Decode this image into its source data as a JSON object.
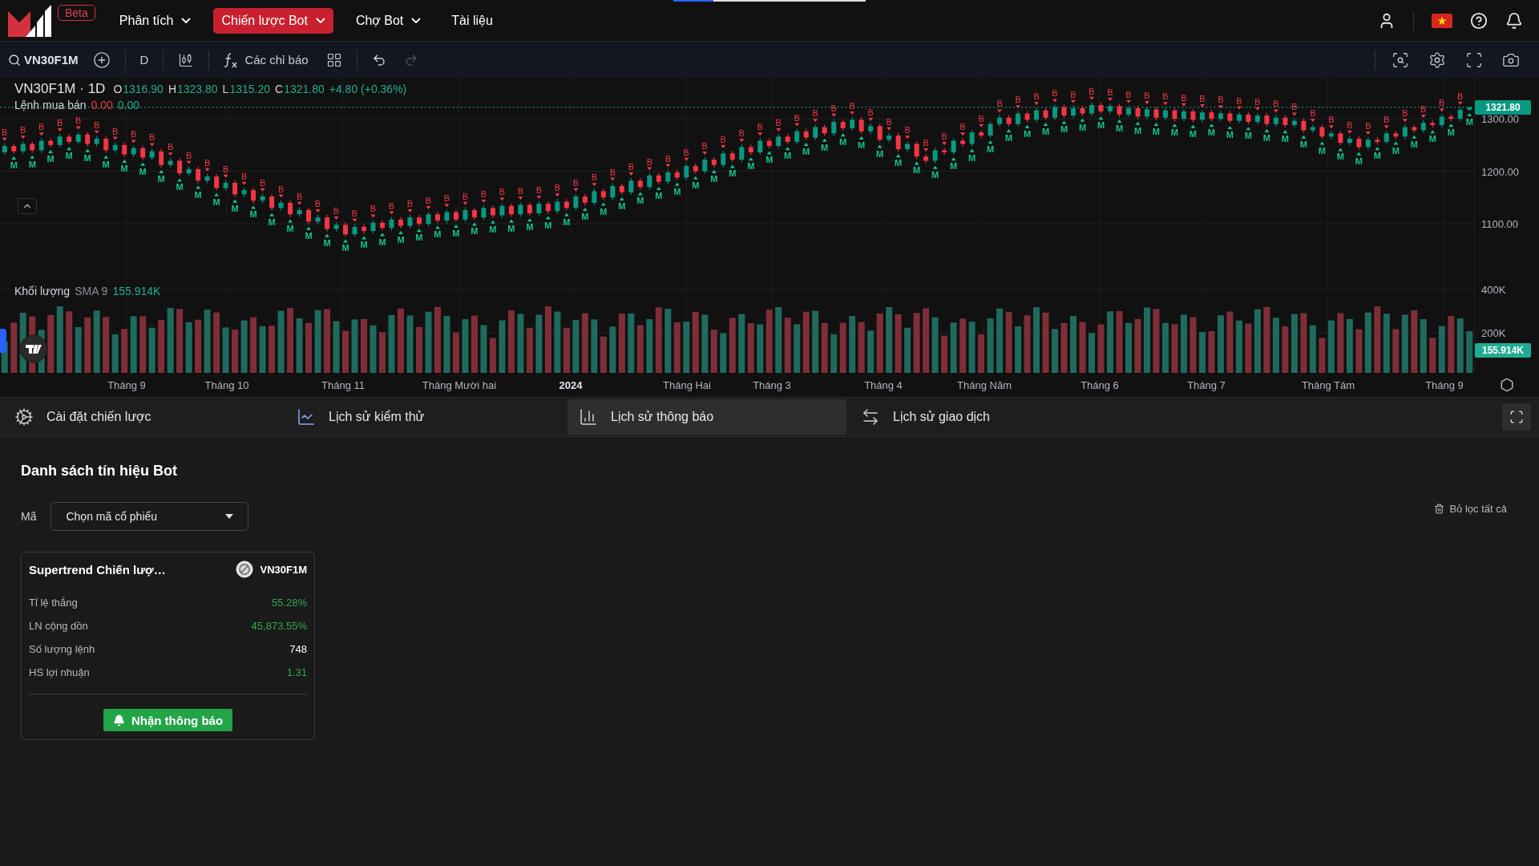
{
  "nav": {
    "beta": "Beta",
    "items": [
      {
        "label": "Phân tích",
        "has_menu": true,
        "selected": false
      },
      {
        "label": "Chiến lược Bot",
        "has_menu": true,
        "selected": true
      },
      {
        "label": "Chợ Bot",
        "has_menu": true,
        "selected": false
      },
      {
        "label": "Tài liệu",
        "has_menu": false,
        "selected": false
      }
    ]
  },
  "toolbar": {
    "symbol": "VN30F1M",
    "interval": "D",
    "indicators": "Các chỉ báo",
    "undo": {
      "disabled": false
    },
    "redo": {
      "disabled": true
    }
  },
  "chart": {
    "title": "VN30F1M · 1D",
    "ohlc": [
      {
        "label": "O",
        "value": "1316.90"
      },
      {
        "label": "H",
        "value": "1323.80"
      },
      {
        "label": "L",
        "value": "1315.20"
      },
      {
        "label": "C",
        "value": "1321.80"
      }
    ],
    "change": "+4.80 (+0.36%)",
    "orders": {
      "label": "Lệnh mua bán",
      "values": [
        {
          "text": "0.00",
          "color": "#f23645"
        },
        {
          "text": "0.00",
          "color": "#22ab94"
        }
      ]
    },
    "volume": {
      "label": "Khối lượng",
      "sma": "SMA 9",
      "value": "155.914K"
    },
    "time_labels": [
      "Tháng 9",
      "Tháng 10",
      "Tháng 11",
      "Tháng Mười hai",
      "2024",
      "Tháng Hai",
      "Tháng 3",
      "Tháng 4",
      "Tháng Năm",
      "Tháng 6",
      "Tháng 7",
      "Tháng Tám",
      "Tháng 9"
    ],
    "last_price": "1321.80",
    "volume_ticks": [
      "400K",
      "200K"
    ],
    "last_volume": "155.914K",
    "chart_data": {
      "type": "candlestick",
      "ylim": [
        816,
        1378
      ],
      "grid": true,
      "ref_lines": [
        {
          "axis": "y",
          "value": 1321.8
        }
      ],
      "categories": [
        null,
        null,
        null,
        null,
        null,
        null,
        null,
        null,
        null,
        null,
        null,
        null,
        null,
        null,
        null,
        null,
        null,
        null,
        null,
        null,
        null,
        null,
        null,
        null,
        null,
        null,
        null,
        null,
        null,
        null,
        null,
        null,
        null,
        null,
        null,
        null,
        null,
        null,
        null,
        null,
        null,
        null,
        null,
        null,
        null,
        null,
        null,
        null,
        null,
        null,
        null,
        null,
        null,
        null,
        null,
        null,
        null,
        null,
        null,
        null,
        null,
        null,
        null,
        null,
        null,
        null,
        null,
        null,
        null,
        null,
        null,
        null,
        null,
        null,
        null,
        null,
        null,
        null,
        null,
        null,
        null,
        null,
        null,
        null,
        null,
        null,
        null,
        null,
        null,
        null,
        null,
        null,
        null,
        null,
        null,
        null,
        null,
        null,
        null,
        null,
        null,
        null,
        null,
        null,
        null,
        null,
        null,
        null,
        null,
        null,
        null,
        null,
        null,
        null,
        null,
        null,
        null,
        null,
        null,
        null,
        null,
        null,
        null,
        null,
        null,
        null,
        null,
        null,
        null,
        null,
        null,
        null,
        null,
        null,
        null,
        null,
        null,
        null,
        null,
        null,
        null,
        null,
        null,
        null,
        null,
        null,
        null,
        null,
        null,
        null,
        null,
        null,
        null,
        null,
        null,
        null,
        null,
        null,
        null,
        null
      ],
      "yticks": [
        {
          "value": 1300,
          "label": "1300.00"
        },
        {
          "value": 1200,
          "label": "1200.00"
        },
        {
          "value": 1100,
          "label": "1100.00"
        }
      ],
      "ohlc": [
        [
          1236,
          1253,
          1231,
          1248
        ],
        [
          1248,
          1253,
          1233,
          1238
        ],
        [
          1238,
          1257,
          1233,
          1252
        ],
        [
          1252,
          1257,
          1235,
          1240
        ],
        [
          1240,
          1263,
          1235,
          1258
        ],
        [
          1258,
          1263,
          1245,
          1250
        ],
        [
          1250,
          1271,
          1245,
          1266
        ],
        [
          1266,
          1271,
          1251,
          1256
        ],
        [
          1256,
          1275,
          1251,
          1270
        ],
        [
          1270,
          1275,
          1247,
          1252
        ],
        [
          1252,
          1267,
          1247,
          1262
        ],
        [
          1262,
          1267,
          1235,
          1240
        ],
        [
          1240,
          1255,
          1235,
          1250
        ],
        [
          1250,
          1255,
          1227,
          1232
        ],
        [
          1232,
          1249,
          1227,
          1244
        ],
        [
          1244,
          1249,
          1221,
          1226
        ],
        [
          1226,
          1243,
          1221,
          1238
        ],
        [
          1238,
          1243,
          1207,
          1212
        ],
        [
          1212,
          1225,
          1207,
          1220
        ],
        [
          1220,
          1225,
          1191,
          1196
        ],
        [
          1196,
          1209,
          1191,
          1204
        ],
        [
          1204,
          1209,
          1177,
          1182
        ],
        [
          1182,
          1195,
          1177,
          1190
        ],
        [
          1190,
          1195,
          1163,
          1168
        ],
        [
          1168,
          1183,
          1163,
          1178
        ],
        [
          1178,
          1183,
          1151,
          1156
        ],
        [
          1156,
          1169,
          1151,
          1164
        ],
        [
          1164,
          1169,
          1139,
          1144
        ],
        [
          1144,
          1157,
          1139,
          1152
        ],
        [
          1152,
          1157,
          1125,
          1130
        ],
        [
          1130,
          1145,
          1125,
          1140
        ],
        [
          1140,
          1145,
          1113,
          1118
        ],
        [
          1118,
          1131,
          1113,
          1126
        ],
        [
          1126,
          1131,
          1099,
          1104
        ],
        [
          1104,
          1117,
          1099,
          1112
        ],
        [
          1112,
          1117,
          1085,
          1090
        ],
        [
          1090,
          1103,
          1085,
          1098
        ],
        [
          1098,
          1103,
          1075,
          1080
        ],
        [
          1080,
          1099,
          1075,
          1094
        ],
        [
          1094,
          1099,
          1081,
          1086
        ],
        [
          1086,
          1107,
          1081,
          1102
        ],
        [
          1102,
          1107,
          1087,
          1092
        ],
        [
          1092,
          1113,
          1087,
          1108
        ],
        [
          1108,
          1113,
          1091,
          1096
        ],
        [
          1096,
          1117,
          1091,
          1112
        ],
        [
          1112,
          1117,
          1095,
          1100
        ],
        [
          1100,
          1123,
          1095,
          1118
        ],
        [
          1118,
          1123,
          1101,
          1106
        ],
        [
          1106,
          1127,
          1101,
          1122
        ],
        [
          1122,
          1127,
          1103,
          1108
        ],
        [
          1108,
          1131,
          1103,
          1126
        ],
        [
          1126,
          1131,
          1107,
          1112
        ],
        [
          1112,
          1135,
          1107,
          1130
        ],
        [
          1130,
          1135,
          1111,
          1116
        ],
        [
          1116,
          1139,
          1111,
          1134
        ],
        [
          1134,
          1139,
          1113,
          1118
        ],
        [
          1118,
          1141,
          1113,
          1136
        ],
        [
          1136,
          1141,
          1115,
          1120
        ],
        [
          1120,
          1143,
          1115,
          1138
        ],
        [
          1138,
          1143,
          1119,
          1124
        ],
        [
          1124,
          1147,
          1119,
          1142
        ],
        [
          1142,
          1147,
          1125,
          1130
        ],
        [
          1130,
          1157,
          1125,
          1152
        ],
        [
          1152,
          1157,
          1135,
          1140
        ],
        [
          1140,
          1167,
          1135,
          1162
        ],
        [
          1162,
          1167,
          1145,
          1150
        ],
        [
          1150,
          1177,
          1145,
          1172
        ],
        [
          1172,
          1177,
          1155,
          1160
        ],
        [
          1160,
          1187,
          1155,
          1182
        ],
        [
          1182,
          1187,
          1165,
          1170
        ],
        [
          1170,
          1197,
          1165,
          1192
        ],
        [
          1192,
          1197,
          1175,
          1180
        ],
        [
          1180,
          1203,
          1175,
          1198
        ],
        [
          1198,
          1203,
          1183,
          1188
        ],
        [
          1188,
          1215,
          1183,
          1210
        ],
        [
          1210,
          1215,
          1195,
          1200
        ],
        [
          1200,
          1227,
          1195,
          1222
        ],
        [
          1222,
          1227,
          1207,
          1212
        ],
        [
          1212,
          1239,
          1207,
          1234
        ],
        [
          1234,
          1239,
          1217,
          1222
        ],
        [
          1222,
          1251,
          1217,
          1246
        ],
        [
          1246,
          1251,
          1231,
          1236
        ],
        [
          1236,
          1263,
          1231,
          1258
        ],
        [
          1258,
          1263,
          1243,
          1248
        ],
        [
          1248,
          1271,
          1243,
          1266
        ],
        [
          1266,
          1271,
          1251,
          1256
        ],
        [
          1256,
          1281,
          1251,
          1276
        ],
        [
          1276,
          1281,
          1259,
          1264
        ],
        [
          1264,
          1289,
          1259,
          1284
        ],
        [
          1284,
          1289,
          1267,
          1272
        ],
        [
          1272,
          1299,
          1267,
          1294
        ],
        [
          1294,
          1299,
          1277,
          1282
        ],
        [
          1282,
          1303,
          1277,
          1298
        ],
        [
          1298,
          1303,
          1271,
          1276
        ],
        [
          1276,
          1291,
          1271,
          1286
        ],
        [
          1286,
          1291,
          1255,
          1260
        ],
        [
          1260,
          1273,
          1255,
          1268
        ],
        [
          1268,
          1273,
          1237,
          1242
        ],
        [
          1242,
          1257,
          1237,
          1252
        ],
        [
          1252,
          1257,
          1223,
          1228
        ],
        [
          1228,
          1233,
          1215,
          1220
        ],
        [
          1220,
          1245,
          1215,
          1240
        ],
        [
          1240,
          1245,
          1231,
          1236
        ],
        [
          1236,
          1263,
          1231,
          1258
        ],
        [
          1258,
          1263,
          1247,
          1252
        ],
        [
          1252,
          1279,
          1247,
          1274
        ],
        [
          1274,
          1279,
          1263,
          1268
        ],
        [
          1268,
          1295,
          1263,
          1290
        ],
        [
          1290,
          1307,
          1285,
          1302
        ],
        [
          1302,
          1307,
          1285,
          1290
        ],
        [
          1290,
          1315,
          1285,
          1310
        ],
        [
          1310,
          1315,
          1293,
          1298
        ],
        [
          1298,
          1321,
          1293,
          1316
        ],
        [
          1316,
          1321,
          1297,
          1302
        ],
        [
          1302,
          1327,
          1297,
          1322
        ],
        [
          1322,
          1327,
          1301,
          1306
        ],
        [
          1306,
          1325,
          1301,
          1320
        ],
        [
          1320,
          1325,
          1305,
          1310
        ],
        [
          1310,
          1331,
          1305,
          1326
        ],
        [
          1326,
          1331,
          1309,
          1314
        ],
        [
          1314,
          1329,
          1309,
          1324
        ],
        [
          1324,
          1329,
          1303,
          1308
        ],
        [
          1308,
          1325,
          1303,
          1320
        ],
        [
          1320,
          1325,
          1299,
          1304
        ],
        [
          1304,
          1323,
          1299,
          1318
        ],
        [
          1318,
          1323,
          1297,
          1302
        ],
        [
          1302,
          1321,
          1297,
          1316
        ],
        [
          1316,
          1321,
          1295,
          1300
        ],
        [
          1300,
          1319,
          1295,
          1314
        ],
        [
          1314,
          1319,
          1293,
          1298
        ],
        [
          1298,
          1317,
          1293,
          1312
        ],
        [
          1312,
          1317,
          1295,
          1300
        ],
        [
          1300,
          1315,
          1295,
          1310
        ],
        [
          1310,
          1315,
          1291,
          1296
        ],
        [
          1296,
          1313,
          1291,
          1308
        ],
        [
          1308,
          1313,
          1289,
          1294
        ],
        [
          1294,
          1311,
          1289,
          1306
        ],
        [
          1306,
          1311,
          1285,
          1290
        ],
        [
          1290,
          1307,
          1285,
          1302
        ],
        [
          1302,
          1307,
          1283,
          1288
        ],
        [
          1288,
          1301,
          1283,
          1296
        ],
        [
          1296,
          1301,
          1273,
          1278
        ],
        [
          1278,
          1289,
          1273,
          1284
        ],
        [
          1284,
          1289,
          1261,
          1266
        ],
        [
          1266,
          1277,
          1261,
          1272
        ],
        [
          1272,
          1277,
          1249,
          1254
        ],
        [
          1254,
          1267,
          1249,
          1262
        ],
        [
          1262,
          1267,
          1241,
          1246
        ],
        [
          1246,
          1265,
          1241,
          1260
        ],
        [
          1260,
          1265,
          1251,
          1256
        ],
        [
          1256,
          1277,
          1251,
          1272
        ],
        [
          1272,
          1277,
          1261,
          1266
        ],
        [
          1266,
          1289,
          1261,
          1284
        ],
        [
          1284,
          1289,
          1273,
          1278
        ],
        [
          1278,
          1297,
          1273,
          1292
        ],
        [
          1292,
          1297,
          1283,
          1288
        ],
        [
          1288,
          1309,
          1283,
          1304
        ],
        [
          1304,
          1309,
          1295,
          1300
        ],
        [
          1300,
          1321.9,
          1295,
          1316.9
        ],
        [
          1316.9,
          1323.8,
          1315.2,
          1321.8
        ]
      ],
      "annotations": [
        "B",
        "M",
        "B",
        "M",
        "B",
        "M",
        "B",
        "M",
        "B",
        "M",
        "B",
        "M",
        "B",
        "M",
        "B",
        "M",
        "B",
        "M",
        "B",
        "M",
        "B",
        "M",
        "B",
        "M",
        "B",
        "M",
        "B",
        "M",
        "B",
        "M",
        "B",
        "M",
        "B",
        "M",
        "B",
        "M",
        "B",
        "M",
        "B",
        "M",
        "B",
        "M",
        "B",
        "M",
        "B",
        "M",
        "B",
        "M",
        "B",
        "M",
        "B",
        "M",
        "B",
        "M",
        "B",
        "M",
        "B",
        "M",
        "B",
        "M",
        "B",
        "M",
        "B",
        "M",
        "B",
        "M",
        "B",
        "M",
        "B",
        "M",
        "B",
        "M",
        "B",
        "M",
        "B",
        "M",
        "B",
        "M",
        "B",
        "M",
        "B",
        "M",
        "B",
        "M",
        "B",
        "M",
        "B",
        "M",
        "B",
        "M",
        "B",
        "M",
        "B",
        "M",
        "B",
        "M",
        "B",
        "M",
        "B",
        "M",
        "B",
        "M",
        "B",
        "M",
        "B",
        "M",
        "B",
        "M",
        "B",
        "M",
        "B",
        "M",
        "B",
        "M",
        "B",
        "M",
        "B",
        "M",
        "B",
        "M",
        "B",
        "M",
        "B",
        "M",
        "B",
        "M",
        "B",
        "M",
        "B",
        "M",
        "B",
        "M",
        "B",
        "M",
        "B",
        "M",
        "B",
        "M",
        "B",
        "M",
        "B",
        "M",
        "B",
        "M",
        "B",
        "M",
        "B",
        "M",
        "B",
        "M",
        "B",
        "M",
        "B",
        "M",
        "B",
        "M",
        "B",
        "M",
        "B",
        "M"
      ]
    }
  },
  "tabs": [
    {
      "label": "Cài đặt chiến lược",
      "selected": false
    },
    {
      "label": "Lịch sử kiểm thử",
      "selected": false
    },
    {
      "label": "Lịch sử thông báo",
      "selected": true
    },
    {
      "label": "Lịch sử giao dịch",
      "selected": false
    }
  ],
  "signals": {
    "title": "Danh sách tín hiệu Bot",
    "filter_label": "Mã",
    "select": {
      "placeholder": "Chọn mã cổ phiếu"
    },
    "clear_filters": "Bỏ lọc tất cả",
    "cards": [
      {
        "name": "Supertrend Chiến lượ…",
        "symbol": "VN30F1M",
        "stats": [
          {
            "label": "Tỉ lệ thắng",
            "value": "55.28%",
            "color": "#2fa84f"
          },
          {
            "label": "LN cộng dồn",
            "value": "45,873.55%",
            "color": "#2fa84f"
          },
          {
            "label": "Số lượng lệnh",
            "value": "748",
            "color": "#ffffff"
          },
          {
            "label": "HS lợi nhuận",
            "value": "1.31",
            "color": "#2fa84f"
          }
        ],
        "action": "Nhận thông báo"
      }
    ]
  }
}
